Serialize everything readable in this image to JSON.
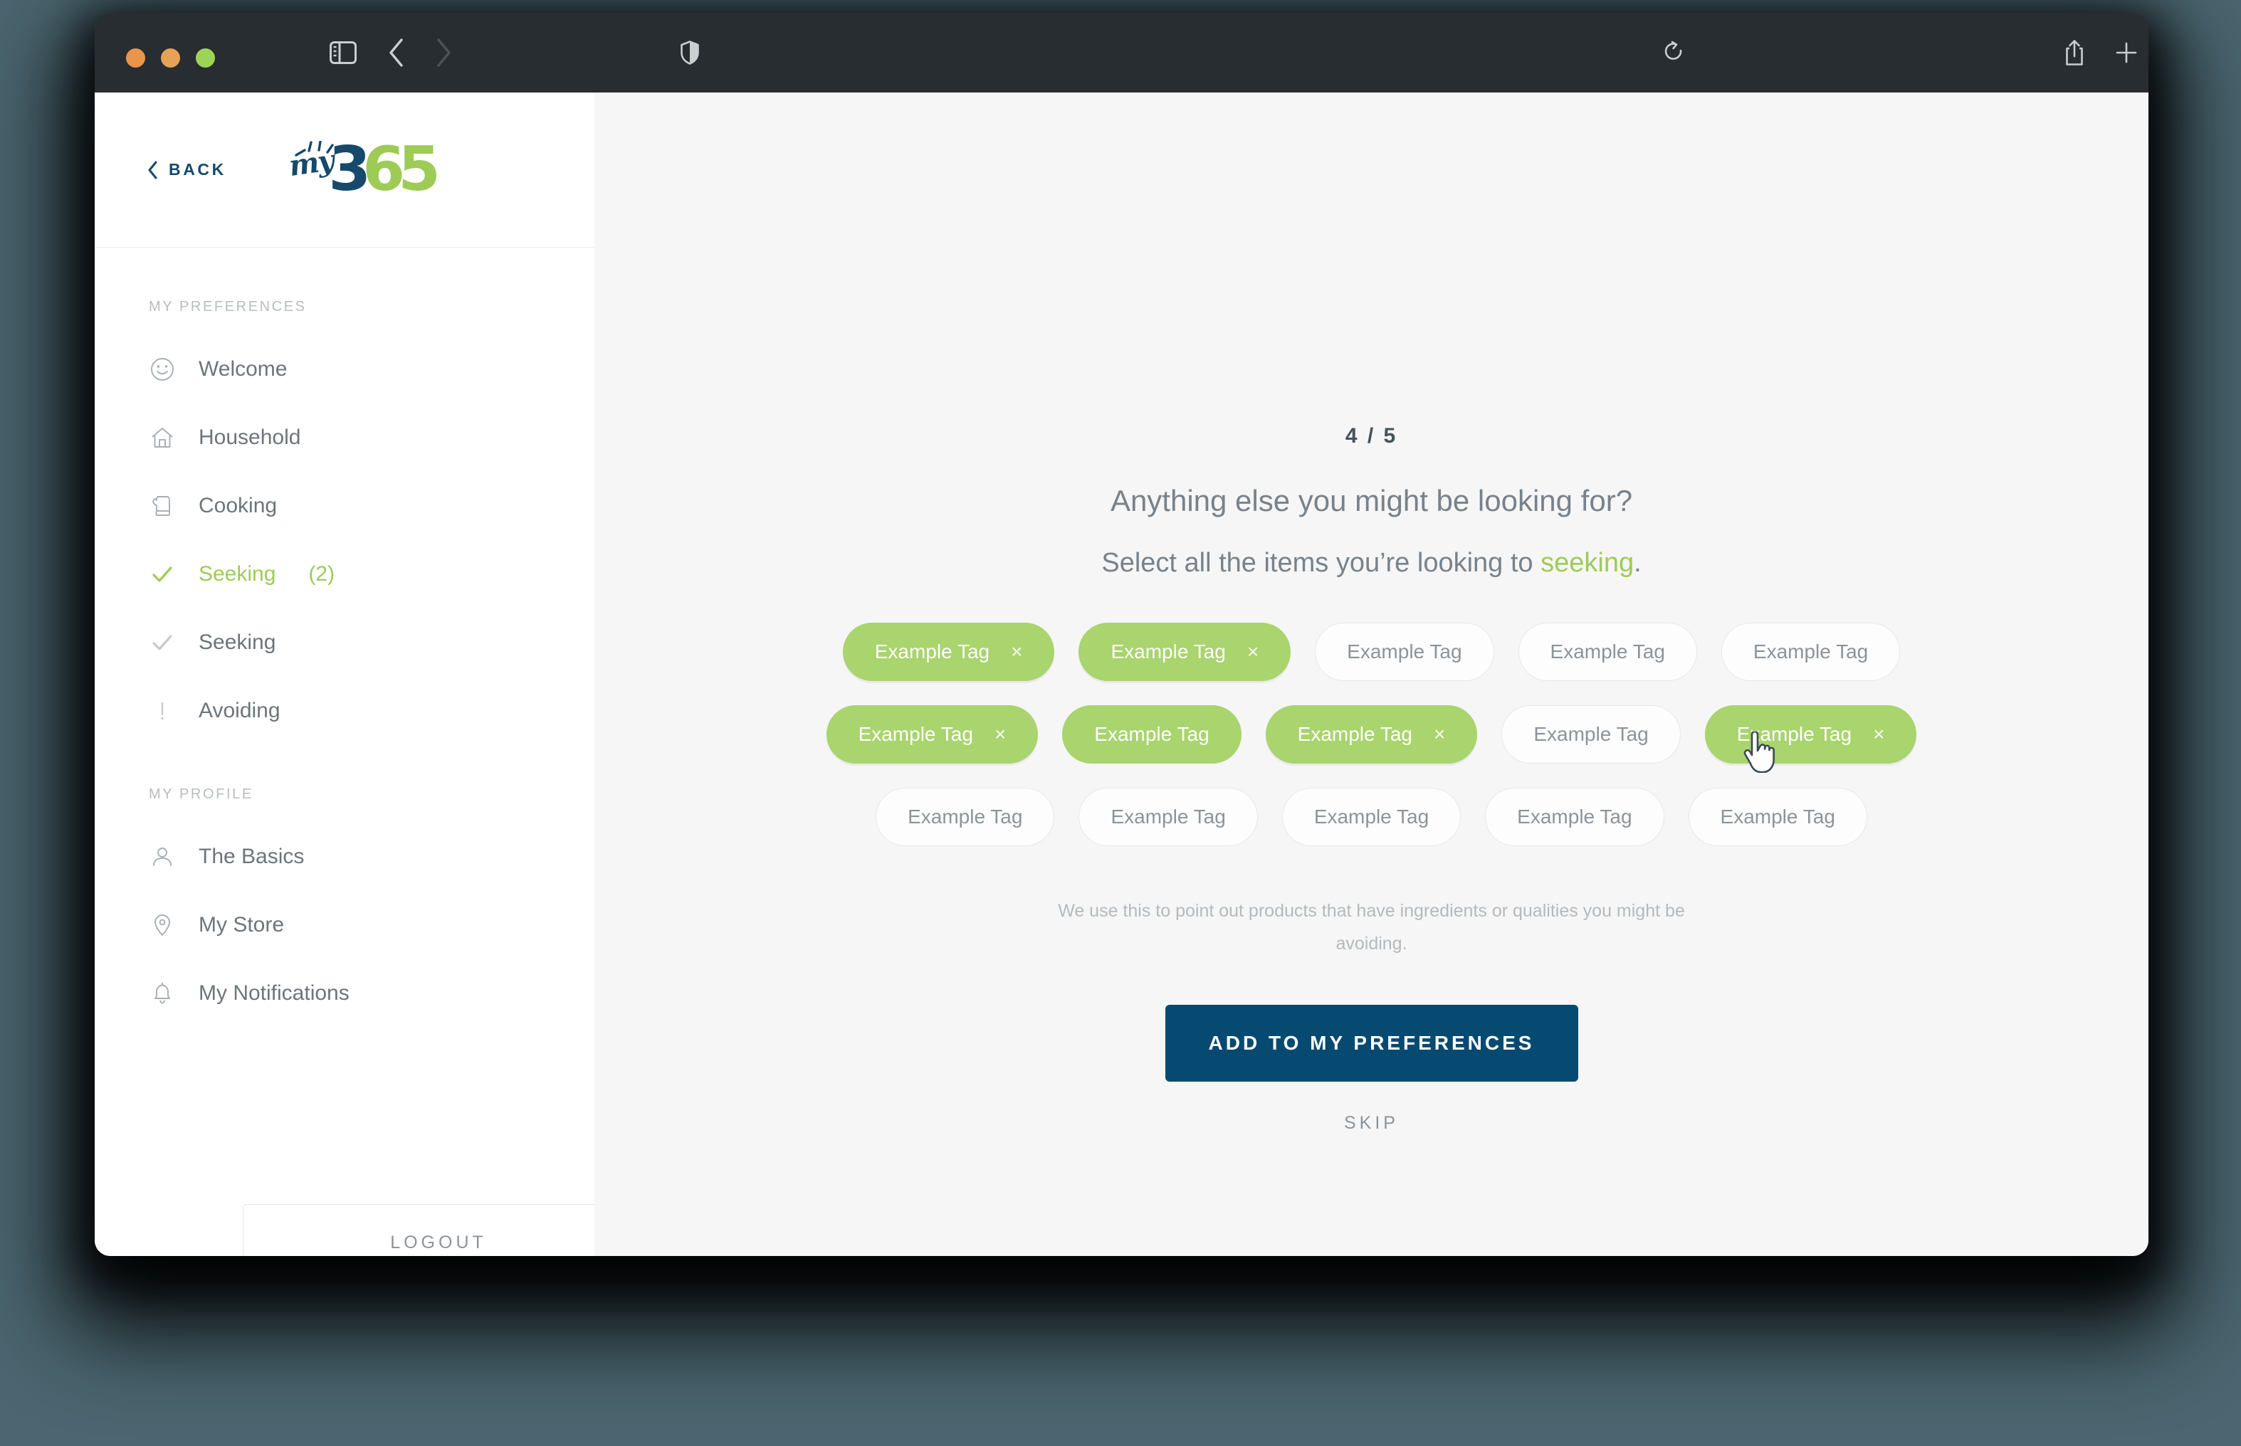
{
  "browser": {
    "traffic_lights": [
      "close",
      "minimize",
      "zoom"
    ],
    "toolbar_icons": [
      "sidebar-toggle-icon",
      "back-arrow-icon",
      "forward-arrow-icon",
      "shield-privacy-icon",
      "reload-icon",
      "share-icon",
      "new-tab-icon",
      "tab-overview-icon"
    ]
  },
  "sidebar": {
    "back_label": "BACK",
    "logo": {
      "my": "my",
      "three": "3",
      "six": "6",
      "five": "5"
    },
    "preferences_label": "MY PREFERENCES",
    "profile_label": "MY PROFILE",
    "preferences_items": [
      {
        "label": "Welcome",
        "icon": "smiley-icon",
        "count": "",
        "state": "done"
      },
      {
        "label": "Household",
        "icon": "house-icon",
        "count": "",
        "state": "done"
      },
      {
        "label": "Cooking",
        "icon": "oven-mitt-icon",
        "count": "",
        "state": "done"
      },
      {
        "label": "Seeking",
        "icon": "check-icon",
        "count": "(2)",
        "state": "active"
      },
      {
        "label": "Seeking",
        "icon": "check-icon",
        "count": "",
        "state": "todo"
      },
      {
        "label": "Avoiding",
        "icon": "exclamation-icon",
        "count": "",
        "state": "todo"
      }
    ],
    "profile_items": [
      {
        "label": "The Basics",
        "icon": "person-icon"
      },
      {
        "label": "My Store",
        "icon": "location-pin-icon"
      },
      {
        "label": "My Notifications",
        "icon": "bell-icon"
      }
    ],
    "logout_label": "LOGOUT"
  },
  "main": {
    "step_counter": "4 / 5",
    "headline": "Anything else you might be looking for?",
    "subline_prefix": "Select all the items you’re looking to ",
    "subline_accent": "seeking",
    "subline_suffix": ".",
    "helper_text": "We use this to point out products that have ingredients or qualities you might be avoiding.",
    "cta_label": "ADD TO MY PREFERENCES",
    "skip_label": "SKIP",
    "tag_remove_glyph": "×",
    "tag_rows": [
      [
        {
          "label": "Example Tag",
          "state": "selected"
        },
        {
          "label": "Example Tag",
          "state": "selected"
        },
        {
          "label": "Example Tag",
          "state": "unselected"
        },
        {
          "label": "Example Tag",
          "state": "unselected"
        },
        {
          "label": "Example Tag",
          "state": "unselected"
        }
      ],
      [
        {
          "label": "Example Tag",
          "state": "selected"
        },
        {
          "label": "Example Tag",
          "state": "hovered"
        },
        {
          "label": "Example Tag",
          "state": "selected"
        },
        {
          "label": "Example Tag",
          "state": "unselected"
        },
        {
          "label": "Example Tag",
          "state": "selected"
        }
      ],
      [
        {
          "label": "Example Tag",
          "state": "unselected"
        },
        {
          "label": "Example Tag",
          "state": "unselected"
        },
        {
          "label": "Example Tag",
          "state": "unselected"
        },
        {
          "label": "Example Tag",
          "state": "unselected"
        },
        {
          "label": "Example Tag",
          "state": "unselected"
        }
      ]
    ]
  },
  "colors": {
    "accent_green": "#a9d46e",
    "brand_navy": "#074a71",
    "backdrop": "#4b6670",
    "titlebar": "#282d31"
  }
}
